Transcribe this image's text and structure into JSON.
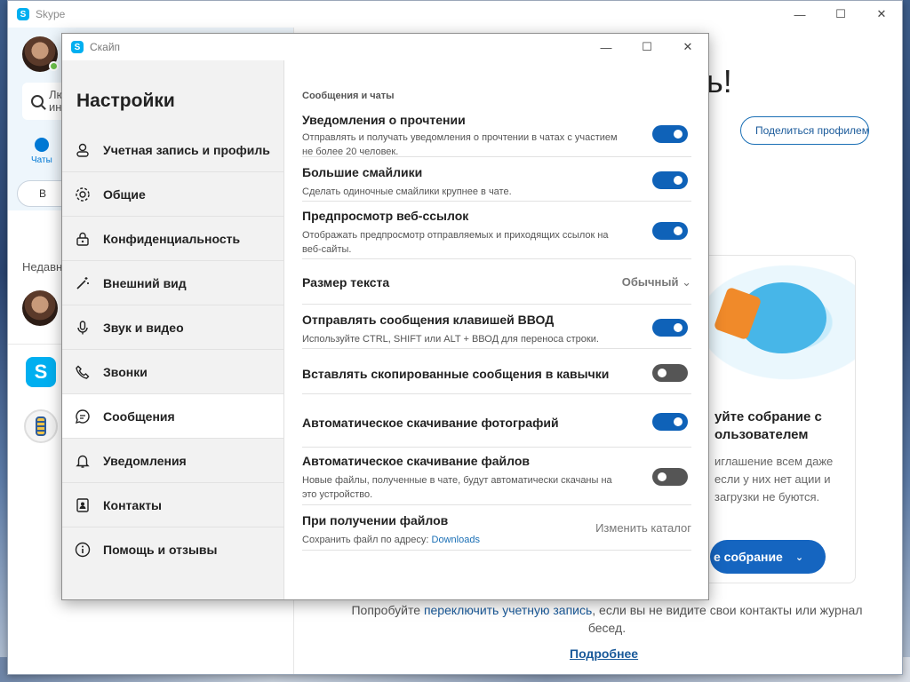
{
  "main_window": {
    "title": "Skype",
    "controls": {
      "minimize": "—",
      "maximize": "☐",
      "close": "✕"
    },
    "search": {
      "placeholder_line1": "Лю",
      "placeholder_line2": "ин"
    },
    "chats_tab": "Чаты",
    "meet_button": "В",
    "recent_label": "Недавн",
    "greeting": "ь!",
    "share_button": "Поделиться профилем",
    "meet_card": {
      "title": "уйте собрание с ользователем",
      "text": "иглашение всем даже если у них нет ации и загрузки не буются.",
      "button": "е собрание"
    },
    "switch_text_before": "Попробуйте ",
    "switch_text_link": "переключить учетную запись",
    "switch_text_after": ", если вы не видите свои контакты или журнал бесед.",
    "more_link": "Подробнее"
  },
  "settings_dialog": {
    "title": "Скайп",
    "heading": "Настройки",
    "nav": [
      {
        "label": "Учетная запись и профиль",
        "icon": "person-icon"
      },
      {
        "label": "Общие",
        "icon": "gear-icon"
      },
      {
        "label": "Конфиденциальность",
        "icon": "lock-icon"
      },
      {
        "label": "Внешний вид",
        "icon": "magic-wand-icon"
      },
      {
        "label": "Звук и видео",
        "icon": "microphone-icon"
      },
      {
        "label": "Звонки",
        "icon": "phone-icon"
      },
      {
        "label": "Сообщения",
        "icon": "chat-bubble-icon",
        "active": true
      },
      {
        "label": "Уведомления",
        "icon": "bell-icon"
      },
      {
        "label": "Контакты",
        "icon": "contact-book-icon"
      },
      {
        "label": "Помощь и отзывы",
        "icon": "info-icon"
      }
    ],
    "section_title": "Сообщения и чаты",
    "settings": [
      {
        "title": "Уведомления о прочтении",
        "desc": "Отправлять и получать уведомления о прочтении в чатах с участием не более 20 человек.",
        "toggle": "on"
      },
      {
        "title": "Большие смайлики",
        "desc": "Сделать одиночные смайлики крупнее в чате.",
        "toggle": "on"
      },
      {
        "title": "Предпросмотр веб-ссылок",
        "desc": "Отображать предпросмотр отправляемых и приходящих ссылок на веб-сайты.",
        "toggle": "on"
      },
      {
        "title": "Размер текста",
        "value": "Обычный"
      },
      {
        "title": "Отправлять сообщения клавишей ВВОД",
        "desc": "Используйте CTRL, SHIFT или ALT + ВВОД для переноса строки.",
        "toggle": "on"
      },
      {
        "title": "Вставлять скопированные сообщения в кавычки",
        "toggle": "off"
      },
      {
        "title": "Автоматическое скачивание фотографий",
        "toggle": "on"
      },
      {
        "title": "Автоматическое скачивание файлов",
        "desc": "Новые файлы, полученные в чате, будут автоматически скачаны на это устройство.",
        "toggle": "off"
      },
      {
        "title": "При получении файлов",
        "desc_prefix": "Сохранить файл по адресу: ",
        "desc_link": "Downloads",
        "action": "Изменить каталог"
      }
    ],
    "colors": {
      "toggle_on": "#0f62b8",
      "toggle_off": "#555555",
      "accent": "#1a6fb5"
    }
  }
}
